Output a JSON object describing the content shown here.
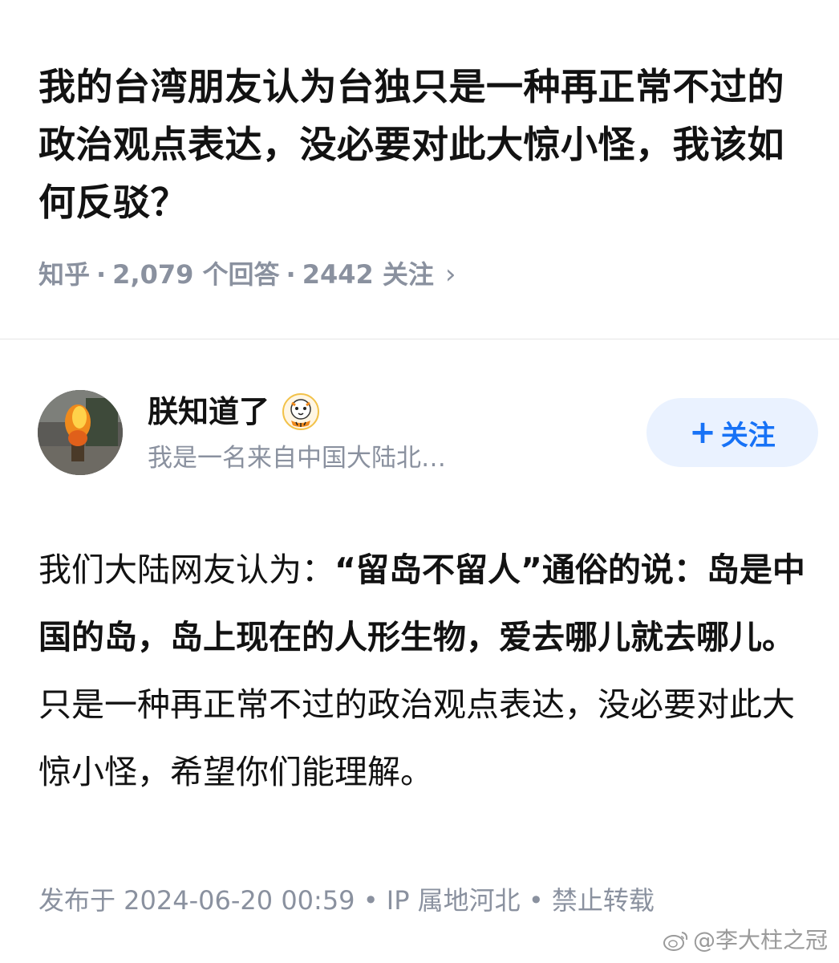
{
  "question": {
    "title": "我的台湾朋友认为台独只是一种再正常不过的政治观点表达，没必要对此大惊小怪，我该如何反驳？",
    "source": "知乎",
    "sep": "·",
    "answers": "2,079 个回答",
    "followers": "2442 关注",
    "chevron": "›"
  },
  "author": {
    "name": "朕知道了",
    "bio": "我是一名来自中国大陆北…",
    "avatar_icon": "avatar-photo",
    "badge_icon": "tiger-badge-icon"
  },
  "follow_button": {
    "plus": "+",
    "label": "关注"
  },
  "answer": {
    "p1": "我们大陆网友认为：",
    "b1": "“留岛不留人”通俗的说：岛是中国的岛，岛上现在的人形生物，爱去哪儿就去哪儿。",
    "p2": "只是一种再正常不过的政治观点表达，没必要对此大惊小怪，希望你们能理解。"
  },
  "footer": {
    "text": "发布于 2024-06-20 00:59 • IP 属地河北 • 禁止转载"
  },
  "watermark": {
    "text": "@李大柱之冠",
    "icon": "weibo-icon"
  },
  "colors": {
    "title": "#121212",
    "meta": "#8a919f",
    "accent": "#1772f6",
    "button_bg": "#eaf2ff"
  }
}
